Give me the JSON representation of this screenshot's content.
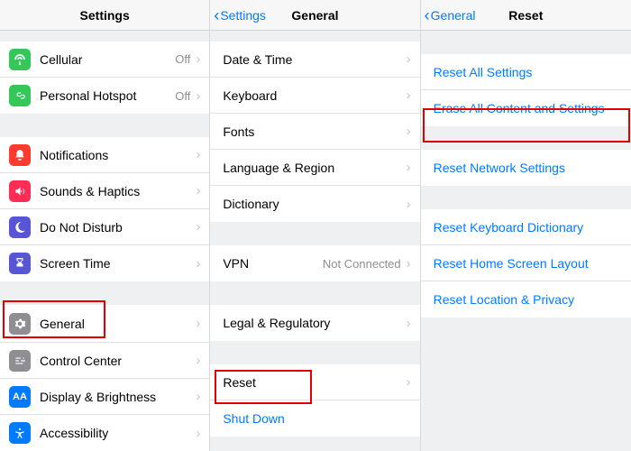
{
  "pane1": {
    "title": "Settings",
    "group1": [
      {
        "icon": "antenna",
        "color": "green",
        "label": "Cellular",
        "value": "Off"
      },
      {
        "icon": "link",
        "color": "green",
        "label": "Personal Hotspot",
        "value": "Off"
      }
    ],
    "group2": [
      {
        "icon": "bell",
        "color": "red",
        "label": "Notifications"
      },
      {
        "icon": "speaker",
        "color": "pink",
        "label": "Sounds & Haptics"
      },
      {
        "icon": "moon",
        "color": "purple",
        "label": "Do Not Disturb"
      },
      {
        "icon": "hourglass",
        "color": "indigo",
        "label": "Screen Time"
      }
    ],
    "group3": [
      {
        "icon": "gear",
        "color": "gray",
        "label": "General"
      },
      {
        "icon": "sliders",
        "color": "gray",
        "label": "Control Center"
      },
      {
        "icon": "aa",
        "color": "blue",
        "label": "Display & Brightness"
      },
      {
        "icon": "access",
        "color": "blue",
        "label": "Accessibility"
      }
    ]
  },
  "pane2": {
    "back": "Settings",
    "title": "General",
    "group1": [
      {
        "label": "Date & Time"
      },
      {
        "label": "Keyboard"
      },
      {
        "label": "Fonts"
      },
      {
        "label": "Language & Region"
      },
      {
        "label": "Dictionary"
      }
    ],
    "group2": [
      {
        "label": "VPN",
        "value": "Not Connected"
      }
    ],
    "group3": [
      {
        "label": "Legal & Regulatory"
      }
    ],
    "group4": [
      {
        "label": "Reset"
      },
      {
        "label": "Shut Down",
        "blue": true,
        "nodisc": true
      }
    ]
  },
  "pane3": {
    "back": "General",
    "title": "Reset",
    "group1": [
      {
        "label": "Reset All Settings"
      },
      {
        "label": "Erase All Content and Settings"
      }
    ],
    "group2": [
      {
        "label": "Reset Network Settings"
      }
    ],
    "group3": [
      {
        "label": "Reset Keyboard Dictionary"
      },
      {
        "label": "Reset Home Screen Layout"
      },
      {
        "label": "Reset Location & Privacy"
      }
    ]
  }
}
